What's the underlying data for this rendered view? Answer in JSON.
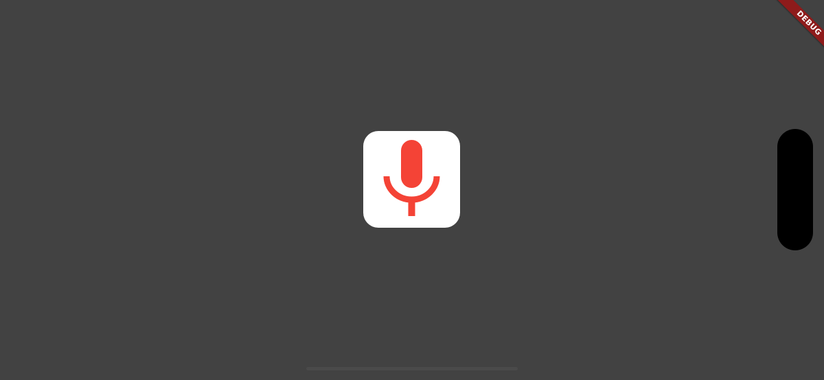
{
  "app": {
    "background_color": "#424242"
  },
  "mic_button": {
    "icon": "microphone-icon",
    "tile_color": "#ffffff",
    "icon_color": "#f44336"
  },
  "debug_banner": {
    "label": "DEBUG",
    "color": "#8e1b1b"
  },
  "device": {
    "notch_color": "#000000"
  }
}
